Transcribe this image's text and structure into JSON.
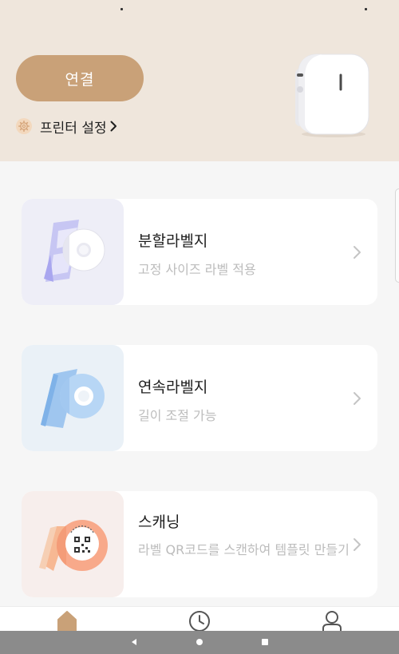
{
  "header": {
    "connect_label": "연결",
    "printer_settings_label": "프린터 설정"
  },
  "cards": [
    {
      "title": "분할라벨지",
      "desc": "고정 사이즈 라벨 적용"
    },
    {
      "title": "연속라벨지",
      "desc": "길이 조절 가능"
    },
    {
      "title": "스캐닝",
      "desc": "라벨 QR코드를 스캔하여 템플릿 만들기"
    }
  ],
  "nav": {
    "items": [
      "home-icon",
      "history-icon",
      "profile-icon"
    ],
    "active": "home-icon"
  },
  "colors": {
    "accent": "#c9a178",
    "header_bg": "#efe6dc",
    "thumb_split": "#eeeef7",
    "thumb_continuous": "#eaf1f7",
    "thumb_scan": "#f7eeec"
  }
}
